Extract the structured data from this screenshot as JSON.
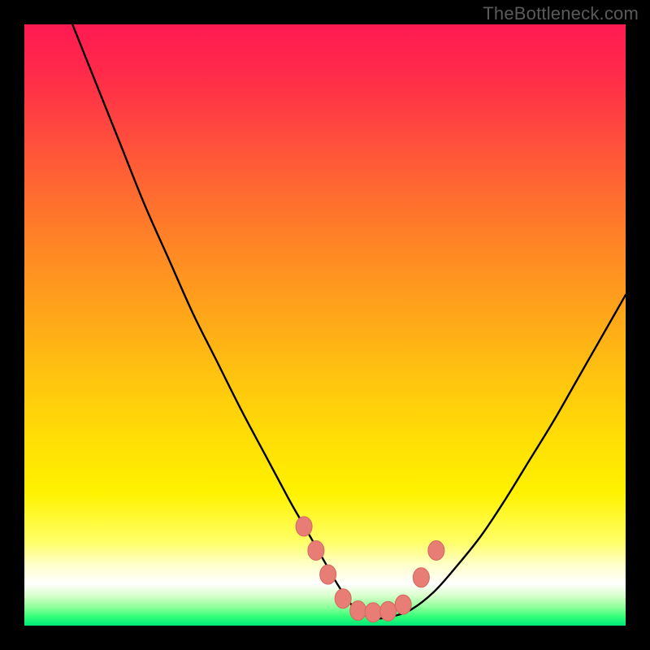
{
  "watermark": {
    "text": "TheBottleneck.com"
  },
  "colors": {
    "curve_stroke": "#000000",
    "marker_fill": "#e77d75",
    "marker_stroke": "#d4675f",
    "frame_bg": "#000000"
  },
  "chart_data": {
    "type": "line",
    "title": "",
    "xlabel": "",
    "ylabel": "",
    "xlim": [
      0,
      100
    ],
    "ylim": [
      0,
      100
    ],
    "series": [
      {
        "name": "bottleneck-curve",
        "x": [
          8,
          12,
          16,
          20,
          24,
          28,
          32,
          36,
          40,
          44,
          46,
          48,
          50,
          52,
          54,
          55,
          56,
          58,
          60,
          64,
          68,
          72,
          76,
          80,
          84,
          88,
          92,
          96,
          100
        ],
        "values": [
          100,
          90,
          80,
          70,
          61,
          52,
          44,
          36,
          28.5,
          21,
          17.5,
          14,
          10.5,
          7,
          4,
          2.8,
          2,
          1.3,
          1.3,
          2.5,
          5.5,
          10,
          15,
          21,
          27.5,
          34,
          41,
          48,
          55
        ]
      }
    ],
    "markers": [
      {
        "x": 46.5,
        "y": 16.5
      },
      {
        "x": 48.5,
        "y": 12.5
      },
      {
        "x": 50.5,
        "y": 8.5
      },
      {
        "x": 53,
        "y": 4.5
      },
      {
        "x": 55.5,
        "y": 2.5
      },
      {
        "x": 58,
        "y": 2.2
      },
      {
        "x": 60.5,
        "y": 2.4
      },
      {
        "x": 63,
        "y": 3.5
      },
      {
        "x": 66,
        "y": 8.0
      },
      {
        "x": 68.5,
        "y": 12.5
      }
    ]
  }
}
